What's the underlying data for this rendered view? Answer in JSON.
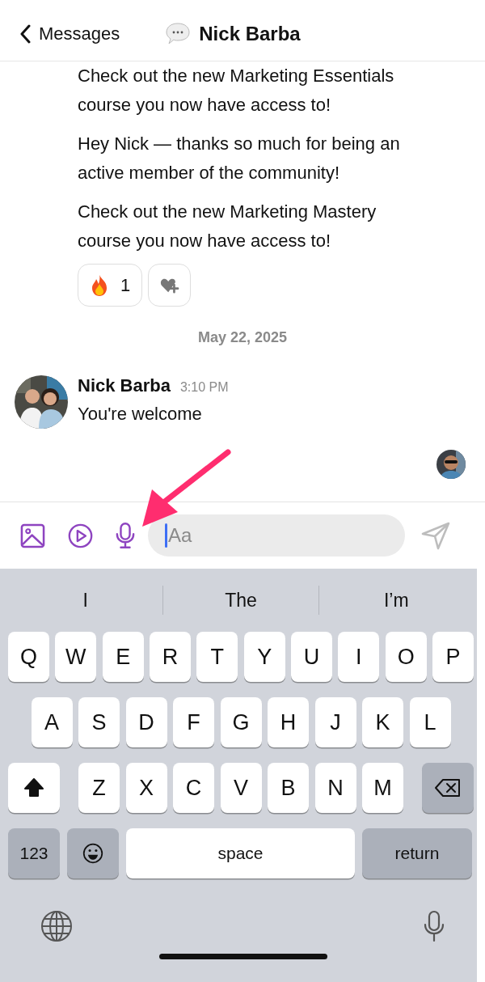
{
  "header": {
    "back_label": "Messages",
    "title": "Nick Barba"
  },
  "earlier_messages": [
    "Check out the new Marketing Essentials course you now have access to!",
    "Hey Nick — thanks so much for being an active member of the community!",
    "Check out the new Marketing Mastery course you now have access to!"
  ],
  "reactions": [
    {
      "count": "1"
    }
  ],
  "date_divider": "May 22, 2025",
  "message": {
    "author": "Nick Barba",
    "time": "3:10 PM",
    "text": "You're welcome"
  },
  "composer": {
    "placeholder": "Aa"
  },
  "keyboard": {
    "suggestions": [
      "I",
      "The",
      "I’m"
    ],
    "letter_rows": [
      [
        "Q",
        "W",
        "E",
        "R",
        "T",
        "Y",
        "U",
        "I",
        "O",
        "P"
      ],
      [
        "A",
        "S",
        "D",
        "F",
        "G",
        "H",
        "J",
        "K",
        "L"
      ],
      [
        "Z",
        "X",
        "C",
        "V",
        "B",
        "N",
        "M"
      ]
    ],
    "shift_on": true,
    "bottom_keys": {
      "numbers": "123",
      "space": "space",
      "return": "return"
    }
  }
}
